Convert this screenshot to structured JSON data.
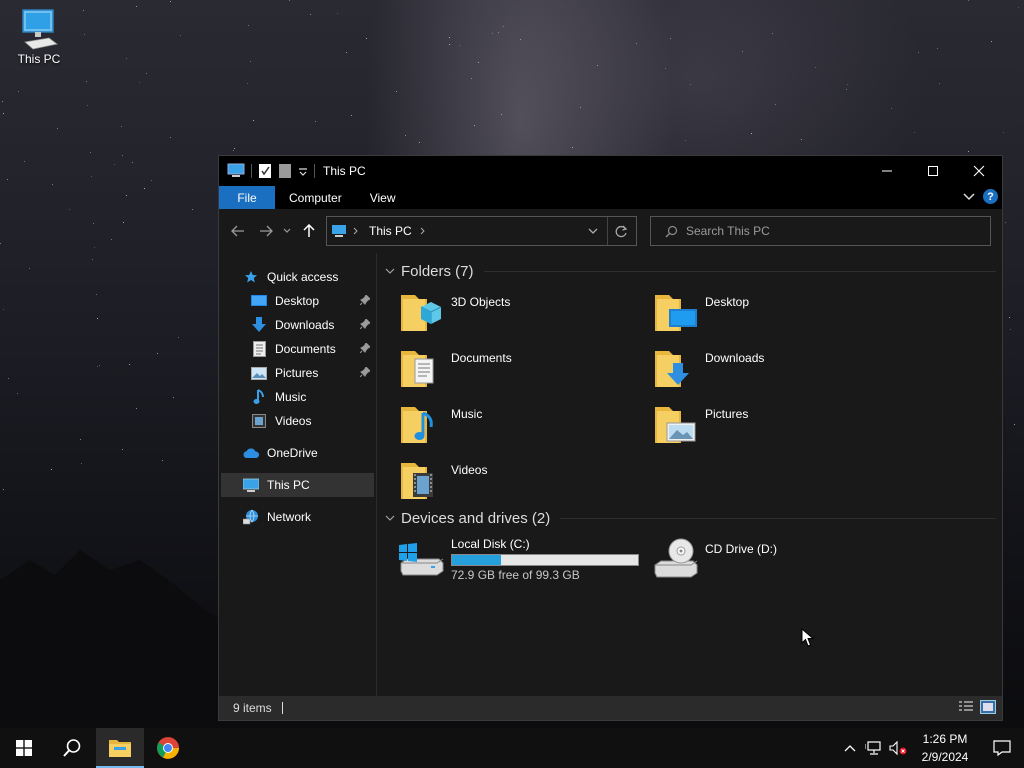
{
  "desktop": {
    "icon_label": "This PC"
  },
  "window": {
    "title": "This PC",
    "ribbon_tabs": [
      "File",
      "Computer",
      "View"
    ],
    "help_glyph": "?",
    "address_path": "This PC",
    "search_placeholder": "Search This PC"
  },
  "sidebar": {
    "quick_access": "Quick access",
    "quick_items": [
      {
        "label": "Desktop",
        "icon": "desktop-folder-icon",
        "pinned": true
      },
      {
        "label": "Downloads",
        "icon": "download-arrow-icon",
        "pinned": true
      },
      {
        "label": "Documents",
        "icon": "document-icon",
        "pinned": true
      },
      {
        "label": "Pictures",
        "icon": "picture-icon",
        "pinned": true
      },
      {
        "label": "Music",
        "icon": "music-note-icon",
        "pinned": false
      },
      {
        "label": "Videos",
        "icon": "film-icon",
        "pinned": false
      }
    ],
    "onedrive": "OneDrive",
    "this_pc": "This PC",
    "network": "Network"
  },
  "main": {
    "folders_header": "Folders (7)",
    "folders": [
      {
        "name": "3D Objects",
        "icon": "3d-objects-folder-icon"
      },
      {
        "name": "Desktop",
        "icon": "desktop-folder-icon"
      },
      {
        "name": "Documents",
        "icon": "documents-folder-icon"
      },
      {
        "name": "Downloads",
        "icon": "downloads-folder-icon"
      },
      {
        "name": "Music",
        "icon": "music-folder-icon"
      },
      {
        "name": "Pictures",
        "icon": "pictures-folder-icon"
      },
      {
        "name": "Videos",
        "icon": "videos-folder-icon"
      }
    ],
    "drives_header": "Devices and drives (2)",
    "drives": [
      {
        "name": "Local Disk (C:)",
        "free_text": "72.9 GB free of 99.3 GB",
        "used_fraction": 0.266
      },
      {
        "name": "CD Drive (D:)"
      }
    ]
  },
  "status": {
    "item_count": "9 items"
  },
  "taskbar": {
    "time": "1:26 PM",
    "date": "2/9/2024"
  },
  "colors": {
    "accent": "#1a6fc0",
    "drive_bar": "#26a0da",
    "folder": "#f0c24a"
  }
}
